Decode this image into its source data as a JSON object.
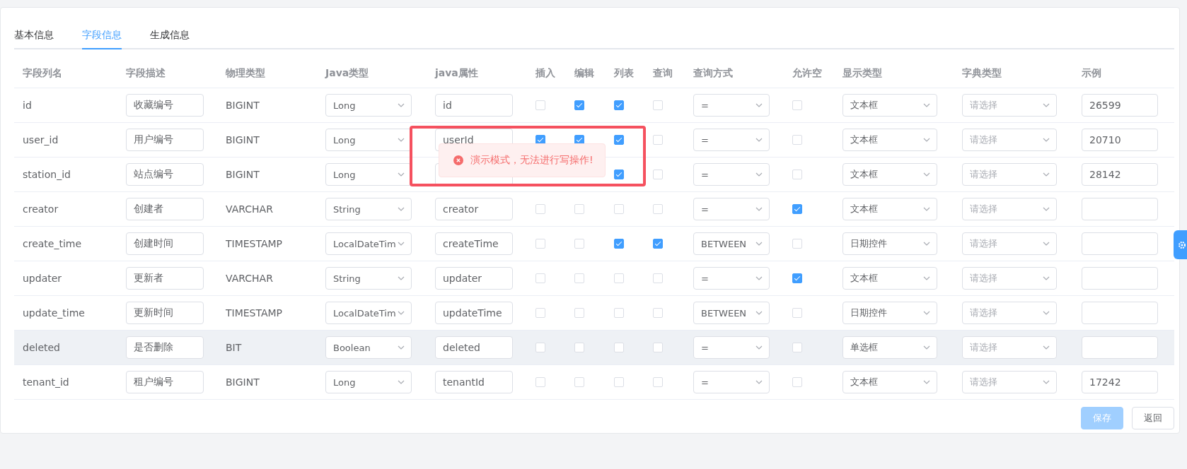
{
  "tabs": [
    {
      "label": "基本信息",
      "selected": false
    },
    {
      "label": "字段信息",
      "selected": true
    },
    {
      "label": "生成信息",
      "selected": false
    }
  ],
  "columns": [
    "字段列名",
    "字段描述",
    "物理类型",
    "Java类型",
    "java属性",
    "插入",
    "编辑",
    "列表",
    "查询",
    "查询方式",
    "允许空",
    "显示类型",
    "字典类型",
    "示例"
  ],
  "rows": [
    {
      "name": "id",
      "description": "收藏编号",
      "physical_type": "BIGINT",
      "java_type": "Long",
      "java_field": "id",
      "insert": false,
      "edit": true,
      "list": true,
      "query": false,
      "query_type": "=",
      "nullable": false,
      "display_type": "文本框",
      "dict_placeholder": "请选择",
      "example": "26599",
      "highlighted": false
    },
    {
      "name": "user_id",
      "description": "用户编号",
      "physical_type": "BIGINT",
      "java_type": "Long",
      "java_field": "userId",
      "insert": true,
      "edit": true,
      "list": true,
      "query": false,
      "query_type": "=",
      "nullable": false,
      "display_type": "文本框",
      "dict_placeholder": "请选择",
      "example": "20710",
      "highlighted": false
    },
    {
      "name": "station_id",
      "description": "站点编号",
      "physical_type": "BIGINT",
      "java_type": "Long",
      "list": true,
      "query": false,
      "query_type": "=",
      "nullable": false,
      "display_type": "文本框",
      "dict_placeholder": "请选择",
      "example": "28142",
      "highlighted": false
    },
    {
      "name": "creator",
      "description": "创建者",
      "physical_type": "VARCHAR",
      "java_type": "String",
      "java_field": "creator",
      "insert": false,
      "edit": false,
      "list": false,
      "query": false,
      "query_type": "=",
      "nullable": true,
      "display_type": "文本框",
      "dict_placeholder": "请选择",
      "highlighted": false
    },
    {
      "name": "create_time",
      "description": "创建时间",
      "physical_type": "TIMESTAMP",
      "java_type": "LocalDateTim",
      "java_field": "createTime",
      "insert": false,
      "edit": false,
      "list": true,
      "query": true,
      "query_type": "BETWEEN",
      "nullable": false,
      "display_type": "日期控件",
      "dict_placeholder": "请选择",
      "highlighted": false
    },
    {
      "name": "updater",
      "description": "更新者",
      "physical_type": "VARCHAR",
      "java_type": "String",
      "java_field": "updater",
      "insert": false,
      "edit": false,
      "list": false,
      "query": false,
      "query_type": "=",
      "nullable": true,
      "display_type": "文本框",
      "dict_placeholder": "请选择",
      "highlighted": false
    },
    {
      "name": "update_time",
      "description": "更新时间",
      "physical_type": "TIMESTAMP",
      "java_type": "LocalDateTim",
      "java_field": "updateTime",
      "insert": false,
      "edit": false,
      "list": false,
      "query": false,
      "query_type": "BETWEEN",
      "nullable": false,
      "display_type": "日期控件",
      "dict_placeholder": "请选择",
      "highlighted": false
    },
    {
      "name": "deleted",
      "description": "是否删除",
      "physical_type": "BIT",
      "java_type": "Boolean",
      "java_field": "deleted",
      "insert": false,
      "edit": false,
      "list": false,
      "query": false,
      "query_type": "=",
      "nullable": false,
      "display_type": "单选框",
      "dict_placeholder": "请选择",
      "highlighted": true
    },
    {
      "name": "tenant_id",
      "description": "租户编号",
      "physical_type": "BIGINT",
      "java_type": "Long",
      "java_field": "tenantId",
      "insert": false,
      "edit": false,
      "list": false,
      "query": false,
      "query_type": "=",
      "nullable": false,
      "display_type": "文本框",
      "dict_placeholder": "请选择",
      "example": "17242",
      "highlighted": false
    }
  ],
  "buttons": [
    {
      "label": "保存",
      "kind": "primary"
    },
    {
      "label": "返回",
      "kind": "default"
    }
  ],
  "toast": {
    "message": "演示模式，无法进行写操作!"
  }
}
